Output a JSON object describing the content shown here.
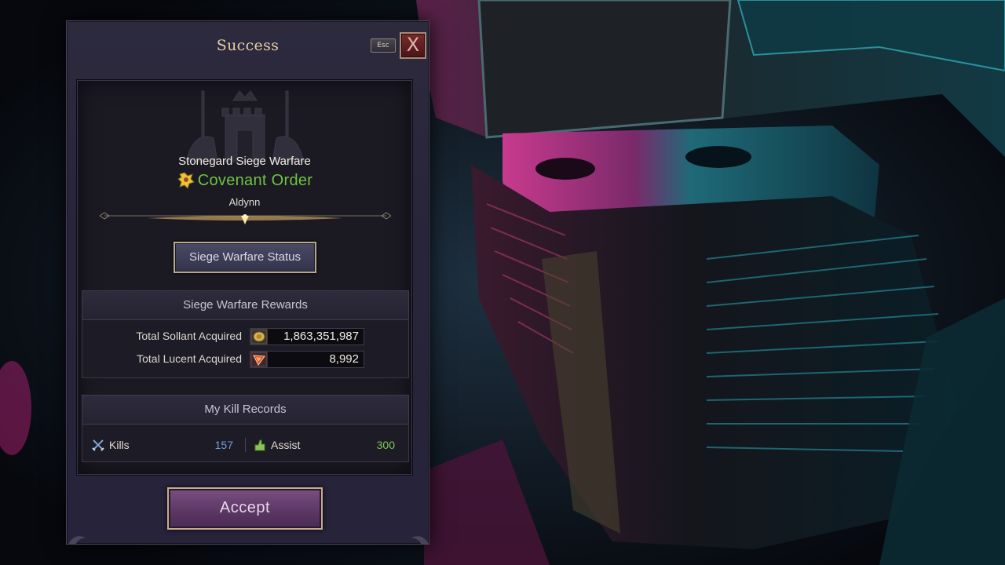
{
  "dialog": {
    "title": "Success",
    "esc_label": "Esc",
    "close_symbol": "X"
  },
  "siege": {
    "name": "Stonegard Siege Warfare",
    "guild_name": "Covenant Order",
    "guild_icon": "lion-crest-icon",
    "server": "Aldynn",
    "status_button_label": "Siege Warfare Status"
  },
  "rewards": {
    "header": "Siege Warfare Rewards",
    "items": [
      {
        "label": "Total Sollant Acquired",
        "icon": "sollant-coin-icon",
        "value": "1,863,351,987"
      },
      {
        "label": "Total Lucent Acquired",
        "icon": "lucent-gem-icon",
        "value": "8,992"
      }
    ]
  },
  "kill_records": {
    "header": "My Kill Records",
    "kills_label": "Kills",
    "kills_value": "157",
    "assist_label": "Assist",
    "assist_value": "300"
  },
  "accept_label": "Accept",
  "colors": {
    "guild_green": "#6fc443",
    "kills_blue": "#6f9fe0",
    "assist_green": "#7bc95a",
    "title_gold": "#e5cfa0"
  }
}
